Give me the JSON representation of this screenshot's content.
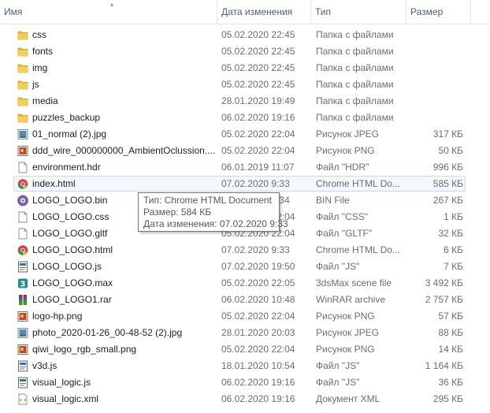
{
  "columns": {
    "name": "Имя",
    "date": "Дата изменения",
    "type": "Тип",
    "size": "Размер"
  },
  "files": [
    {
      "icon": "folder-icon",
      "name": "css",
      "date": "05.02.2020 22:45",
      "type": "Папка с файлами",
      "size": ""
    },
    {
      "icon": "folder-icon",
      "name": "fonts",
      "date": "05.02.2020 22:45",
      "type": "Папка с файлами",
      "size": ""
    },
    {
      "icon": "folder-icon",
      "name": "img",
      "date": "05.02.2020 22:45",
      "type": "Папка с файлами",
      "size": ""
    },
    {
      "icon": "folder-icon",
      "name": "js",
      "date": "05.02.2020 22:45",
      "type": "Папка с файлами",
      "size": ""
    },
    {
      "icon": "folder-icon",
      "name": "media",
      "date": "28.01.2020 19:49",
      "type": "Папка с файлами",
      "size": ""
    },
    {
      "icon": "folder-icon",
      "name": "puzzles_backup",
      "date": "06.02.2020 19:16",
      "type": "Папка с файлами",
      "size": ""
    },
    {
      "icon": "jpeg-image-icon",
      "name": "01_normal (2).jpg",
      "date": "05.02.2020 22:04",
      "type": "Рисунок JPEG",
      "size": "317 КБ"
    },
    {
      "icon": "png-image-icon",
      "name": "ddd_wire_000000000_AmbientOclussion....",
      "date": "05.02.2020 22:04",
      "type": "Рисунок PNG",
      "size": "50 КБ"
    },
    {
      "icon": "file-icon",
      "name": "environment.hdr",
      "date": "06.01.2019 11:07",
      "type": "Файл \"HDR\"",
      "size": "996 КБ"
    },
    {
      "icon": "chrome-html-icon",
      "name": "index.html",
      "date": "07.02.2020 9:33",
      "type": "Chrome HTML Do...",
      "size": "585 КБ"
    },
    {
      "icon": "bin-file-icon",
      "name": "LOGO_LOGO.bin",
      "date": "07.02.2020 9:34",
      "type": "BIN File",
      "size": "267 КБ"
    },
    {
      "icon": "file-icon",
      "name": "LOGO_LOGO.css",
      "date": "05.02.2020 22:04",
      "type": "Файл \"CSS\"",
      "size": "1 КБ"
    },
    {
      "icon": "file-icon",
      "name": "LOGO_LOGO.gltf",
      "date": "05.02.2020 22:04",
      "type": "Файл \"GLTF\"",
      "size": "32 КБ"
    },
    {
      "icon": "chrome-html-icon",
      "name": "LOGO_LOGO.html",
      "date": "07.02.2020 9:33",
      "type": "Chrome HTML Do...",
      "size": "6 КБ"
    },
    {
      "icon": "js-script-icon",
      "name": "LOGO_LOGO.js",
      "date": "07.02.2020 19:50",
      "type": "Файл \"JS\"",
      "size": "7 КБ"
    },
    {
      "icon": "3dsmax-icon",
      "name": "LOGO_LOGO.max",
      "date": "05.02.2020 22:05",
      "type": "3dsMax scene file",
      "size": "3 492 КБ"
    },
    {
      "icon": "winrar-icon",
      "name": "LOGO_LOGO1.rar",
      "date": "06.02.2020 10:48",
      "type": "WinRAR archive",
      "size": "2 757 КБ"
    },
    {
      "icon": "png-image-icon",
      "name": "logo-hp.png",
      "date": "05.02.2020 22:04",
      "type": "Рисунок PNG",
      "size": "57 КБ"
    },
    {
      "icon": "jpeg-image-icon",
      "name": "photo_2020-01-26_00-48-52 (2).jpg",
      "date": "28.01.2020 20:03",
      "type": "Рисунок JPEG",
      "size": "88 КБ"
    },
    {
      "icon": "png-image-icon",
      "name": "qiwi_logo_rgb_small.png",
      "date": "05.02.2020 22:04",
      "type": "Рисунок PNG",
      "size": "14 КБ"
    },
    {
      "icon": "js-script-icon",
      "name": "v3d.js",
      "date": "18.01.2020 10:54",
      "type": "Файл \"JS\"",
      "size": "1 164 КБ"
    },
    {
      "icon": "js-script-icon",
      "name": "visual_logic.js",
      "date": "06.02.2020 19:16",
      "type": "Файл \"JS\"",
      "size": "36 КБ"
    },
    {
      "icon": "xml-document-icon",
      "name": "visual_logic.xml",
      "date": "06.02.2020 19:16",
      "type": "Документ XML",
      "size": "295 КБ"
    }
  ],
  "selected_index": 9,
  "tooltip": {
    "type_line": "Тип: Chrome HTML Document",
    "size_line": "Размер: 584 КБ",
    "date_line": "Дата изменения: 07.02.2020 9:33"
  },
  "colors": {
    "folder": "#e8b940",
    "header_text": "#4c607a",
    "selection_border": "#c4dcf3",
    "selection_fill": "#f3f8fd"
  }
}
